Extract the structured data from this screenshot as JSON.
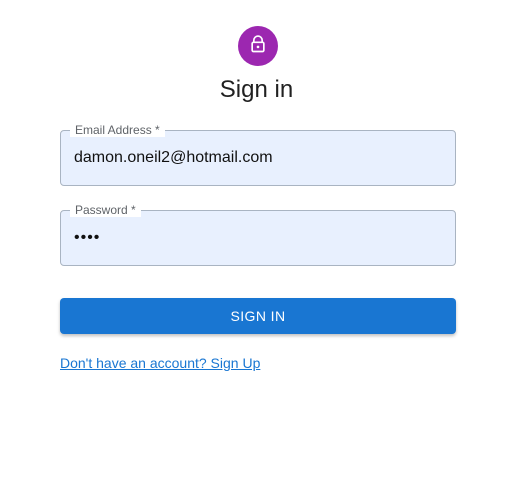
{
  "header": {
    "avatar_icon": "lock-icon",
    "avatar_color": "#9c27b0",
    "title": "Sign in"
  },
  "form": {
    "email": {
      "label": "Email Address *",
      "value": "damon.oneil2@hotmail.com"
    },
    "password": {
      "label": "Password *",
      "masked_value": "••••"
    },
    "submit_label": "SIGN IN",
    "signup_link": "Don't have an account? Sign Up"
  },
  "colors": {
    "primary": "#1976d2",
    "field_background": "#e8f0fe"
  }
}
